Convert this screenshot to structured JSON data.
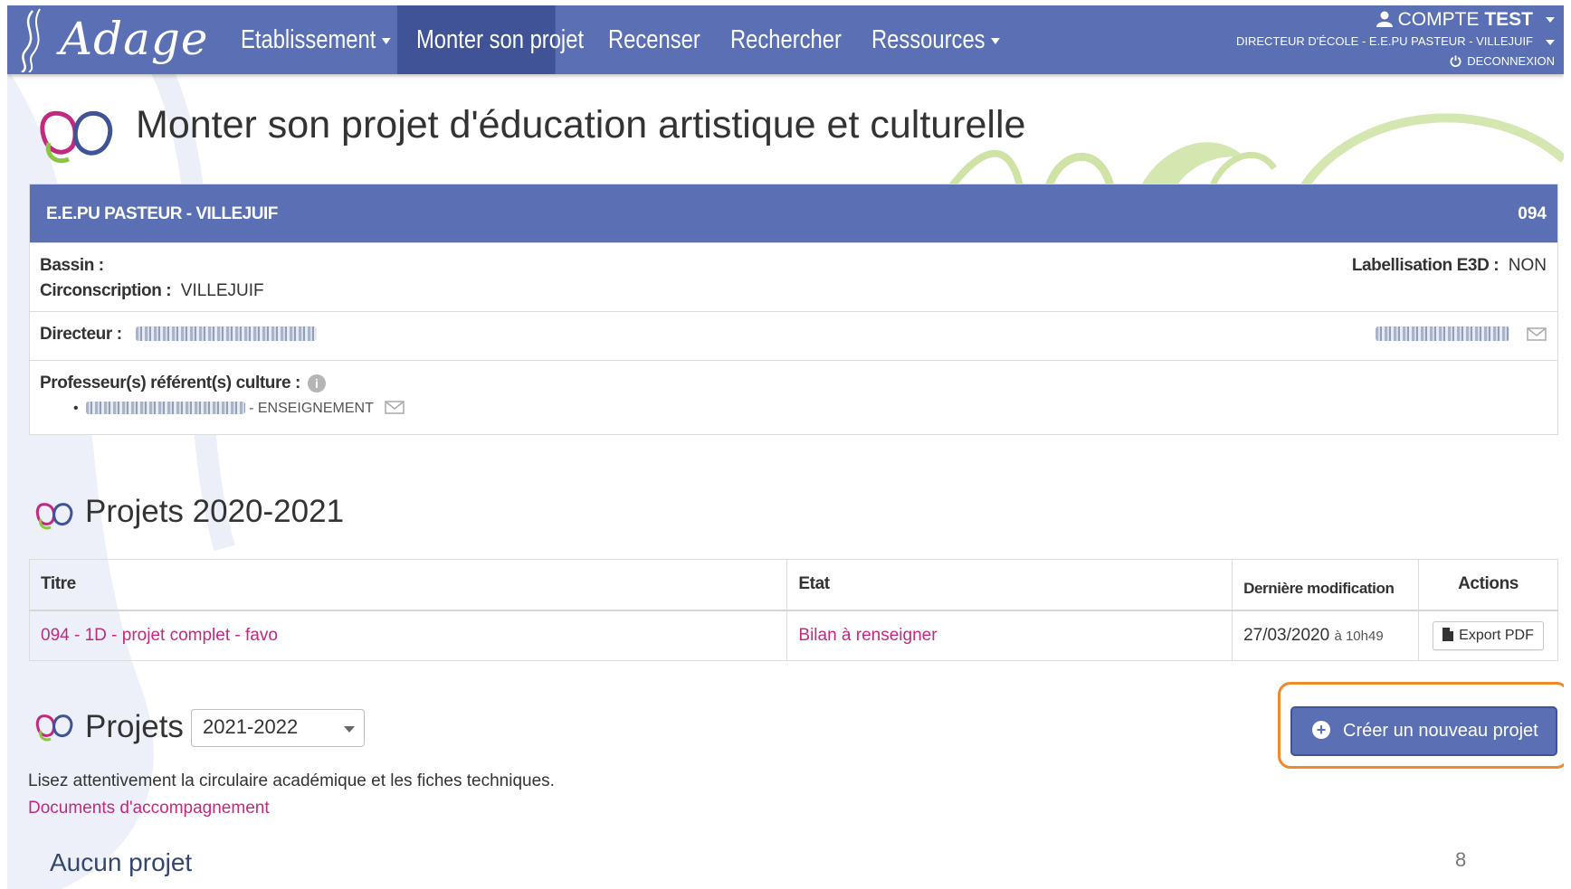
{
  "app": {
    "logo_text": "Adage"
  },
  "navbar": {
    "items": [
      {
        "label": "Etablissement",
        "dropdown": true
      },
      {
        "label": "Monter son projet",
        "active": true
      },
      {
        "label": "Recenser"
      },
      {
        "label": "Rechercher"
      },
      {
        "label": "Ressources",
        "dropdown": true
      }
    ],
    "account": {
      "prefix": "COMPTE",
      "name": "TEST",
      "role": "DIRECTEUR D'ÉCOLE - E.E.PU PASTEUR - VILLEJUIF",
      "logout": "DECONNEXION"
    }
  },
  "page": {
    "title": "Monter son projet d'éducation artistique et culturelle"
  },
  "establishment": {
    "name": "E.E.PU PASTEUR - VILLEJUIF",
    "code": "094",
    "bassin_label": "Bassin :",
    "bassin_value": "",
    "circonscription_label": "Circonscription :",
    "circonscription_value": "VILLEJUIF",
    "labellisation_label": "Labellisation E3D :",
    "labellisation_value": "NON",
    "directeur_label": "Directeur :",
    "professeur_label": "Professeur(s) référent(s) culture :",
    "professeur_role": "- ENSEIGNEMENT"
  },
  "projects_current": {
    "title": "Projets 2020-2021",
    "columns": [
      "Titre",
      "Etat",
      "Dernière modification",
      "Actions"
    ],
    "rows": [
      {
        "title": "094 - 1D - projet complet - favo",
        "state": "Bilan à renseigner",
        "date": "27/03/2020",
        "time": "à 10h49",
        "action": "Export PDF"
      }
    ]
  },
  "projects_next": {
    "title": "Projets",
    "year": "2021-2022",
    "create_button": "Créer un nouveau projet",
    "note": "Lisez attentivement la circulaire académique et les fiches techniques.",
    "doc_link": "Documents d'accompagnement",
    "empty": "Aucun projet"
  },
  "page_number": "8",
  "colors": {
    "nav_bg": "#5a6fb4",
    "nav_active": "#3f5396",
    "link": "#c2297f",
    "highlight": "#ee8a2b"
  }
}
